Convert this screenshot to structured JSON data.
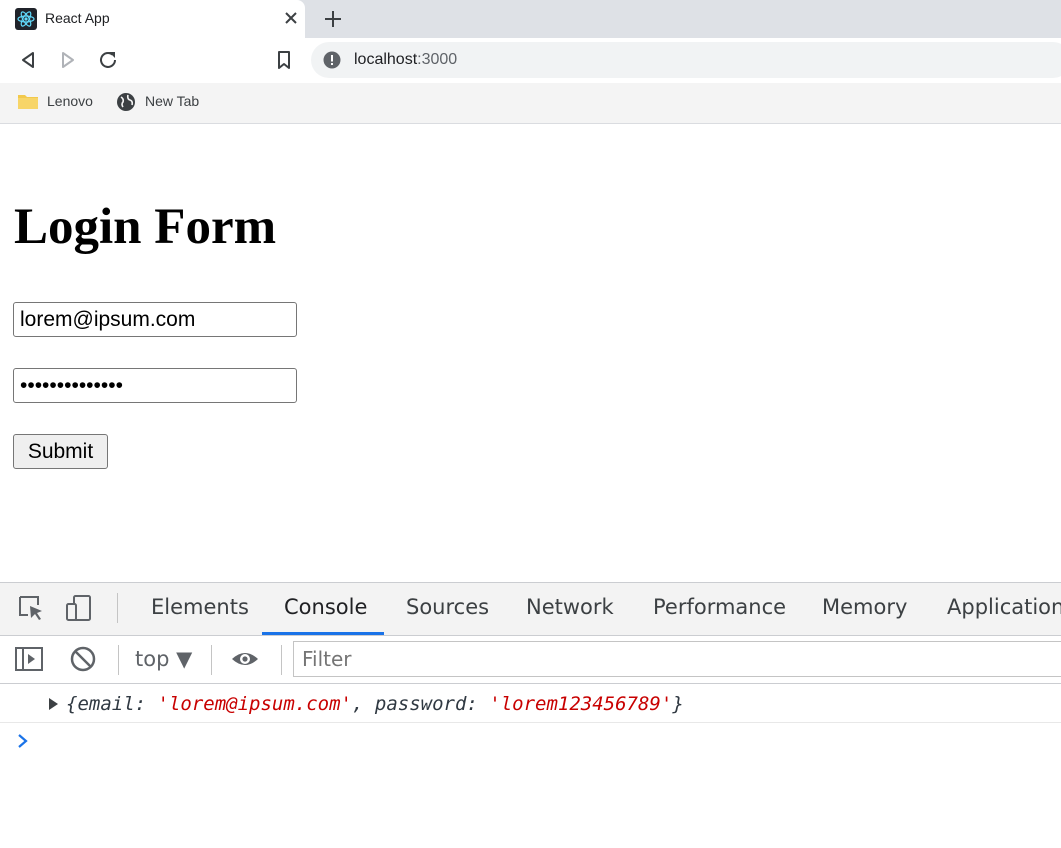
{
  "browser": {
    "tab_title": "React App",
    "url_host": "localhost",
    "url_port": ":3000",
    "bookmarks": [
      {
        "label": "Lenovo",
        "icon": "folder-icon"
      },
      {
        "label": "New Tab",
        "icon": "globe-icon"
      }
    ]
  },
  "page": {
    "heading": "Login Form",
    "email_value": "lorem@ipsum.com",
    "password_value": "lorem123456789",
    "submit_label": "Submit"
  },
  "devtools": {
    "tabs": [
      "Elements",
      "Console",
      "Sources",
      "Network",
      "Performance",
      "Memory",
      "Application"
    ],
    "active_tab": "Console",
    "context": "top",
    "filter_placeholder": "Filter",
    "log": {
      "open_brace": "{",
      "email_key": "email: ",
      "email_value": "'lorem@ipsum.com'",
      "separator": ", ",
      "password_key": "password: ",
      "password_value": "'lorem123456789'",
      "close_brace": "}"
    }
  },
  "colors": {
    "accent": "#1a73e8",
    "console_string": "#c80000",
    "tabstrip": "#dee1e6"
  }
}
